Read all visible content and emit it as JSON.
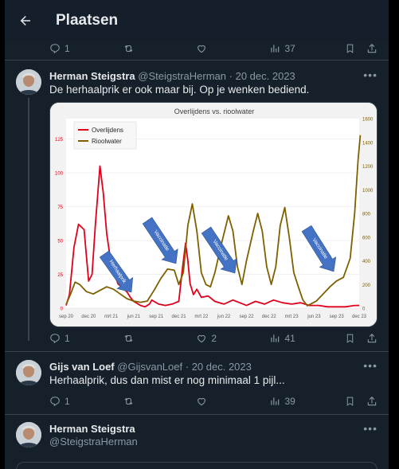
{
  "header": {
    "title": "Plaatsen"
  },
  "top_actions": {
    "replies": "1",
    "views": "37"
  },
  "tweet1": {
    "name": "Herman Steigstra",
    "handle": "@SteigstraHerman",
    "date": "· 20 dec. 2023",
    "text": "De herhaalprik er ook maar bij. Op je wenken bediend.",
    "replies": "1",
    "likes": "2",
    "views": "41"
  },
  "tweet2": {
    "name": "Gijs van Loef",
    "handle": "@GijsvanLoef",
    "date": "· 20 dec. 2023",
    "text": "Herhaalprik, dus dan mist er nog minimaal 1 pijl...",
    "replies": "1",
    "views": "39"
  },
  "tweet3": {
    "name": "Herman Steigstra",
    "handle": "@SteigstraHerman"
  },
  "colors": {
    "background": "#15202b",
    "border": "#38444d",
    "muted": "#8b98a5",
    "deaths": "#e0001a",
    "sewage": "#7f6000",
    "arrow": "#4472c4"
  },
  "chart_data": {
    "type": "line",
    "title": "Overlijdens vs. rioolwater",
    "x_ticks": [
      "sep 20",
      "dec 20",
      "mrt 21",
      "jun 21",
      "sep 21",
      "dec 21",
      "mrt 22",
      "jun 22",
      "sep 22",
      "dec 22",
      "mrt 23",
      "jun 23",
      "sep 23",
      "dec 23"
    ],
    "y_left_ticks": [
      "0",
      "25",
      "50",
      "75",
      "100",
      "125"
    ],
    "y_right_ticks": [
      "0",
      "200",
      "400",
      "600",
      "800",
      "1000",
      "1200",
      "1400",
      "1600"
    ],
    "ylim_left": [
      0,
      140
    ],
    "ylim_right": [
      0,
      1600
    ],
    "legend_position": "top-left",
    "series": [
      {
        "name": "Overlijdens",
        "axis": "left",
        "x": [
          0,
          0.15,
          0.35,
          0.55,
          0.8,
          1.0,
          1.15,
          1.3,
          1.5,
          1.65,
          1.8,
          1.95,
          2.1,
          2.3,
          2.5,
          2.7,
          2.85,
          3.0,
          3.3,
          3.5,
          3.7,
          3.8,
          3.9,
          4.1,
          4.4,
          4.7,
          5.0,
          5.15,
          5.3,
          5.4,
          5.5,
          5.65,
          5.8,
          6.0,
          6.3,
          6.6,
          7.0,
          7.4,
          7.7,
          8.0,
          8.4,
          8.8,
          9.2,
          9.6,
          10.0,
          10.4,
          10.8,
          11.2,
          11.6,
          12.0,
          12.4,
          12.8,
          13.0
        ],
        "y": [
          2,
          10,
          45,
          62,
          58,
          20,
          25,
          62,
          105,
          85,
          55,
          38,
          28,
          18,
          15,
          12,
          8,
          5,
          2,
          1,
          3,
          6,
          5,
          3,
          2,
          3,
          5,
          28,
          48,
          35,
          18,
          10,
          14,
          8,
          9,
          5,
          3,
          6,
          4,
          2,
          5,
          3,
          6,
          4,
          3,
          4,
          2,
          2,
          1,
          1,
          1,
          2,
          2
        ]
      },
      {
        "name": "Rioolwater",
        "axis": "right",
        "x": [
          0,
          0.2,
          0.4,
          0.6,
          0.9,
          1.2,
          1.5,
          1.8,
          2.1,
          2.4,
          2.7,
          3.0,
          3.3,
          3.6,
          3.9,
          4.2,
          4.5,
          4.8,
          5.0,
          5.2,
          5.4,
          5.6,
          5.8,
          6.0,
          6.2,
          6.4,
          6.6,
          6.9,
          7.2,
          7.4,
          7.6,
          7.8,
          8.0,
          8.3,
          8.5,
          8.7,
          8.9,
          9.1,
          9.3,
          9.5,
          9.7,
          9.9,
          10.1,
          10.3,
          10.5,
          10.7,
          10.9,
          11.1,
          11.4,
          11.7,
          12.0,
          12.3,
          12.6,
          12.8,
          12.95,
          13.05
        ],
        "y": [
          30,
          120,
          220,
          200,
          140,
          120,
          150,
          180,
          160,
          120,
          80,
          60,
          50,
          60,
          150,
          250,
          330,
          320,
          200,
          300,
          700,
          880,
          650,
          300,
          200,
          180,
          300,
          550,
          780,
          650,
          350,
          200,
          400,
          650,
          800,
          650,
          350,
          200,
          350,
          700,
          850,
          600,
          300,
          180,
          70,
          20,
          40,
          60,
          120,
          180,
          230,
          260,
          420,
          800,
          1250,
          1460
        ]
      }
    ],
    "annotations": [
      "Herhaalprik",
      "Vaccinatie",
      "Vaccinatie",
      "Vaccinatie"
    ]
  }
}
